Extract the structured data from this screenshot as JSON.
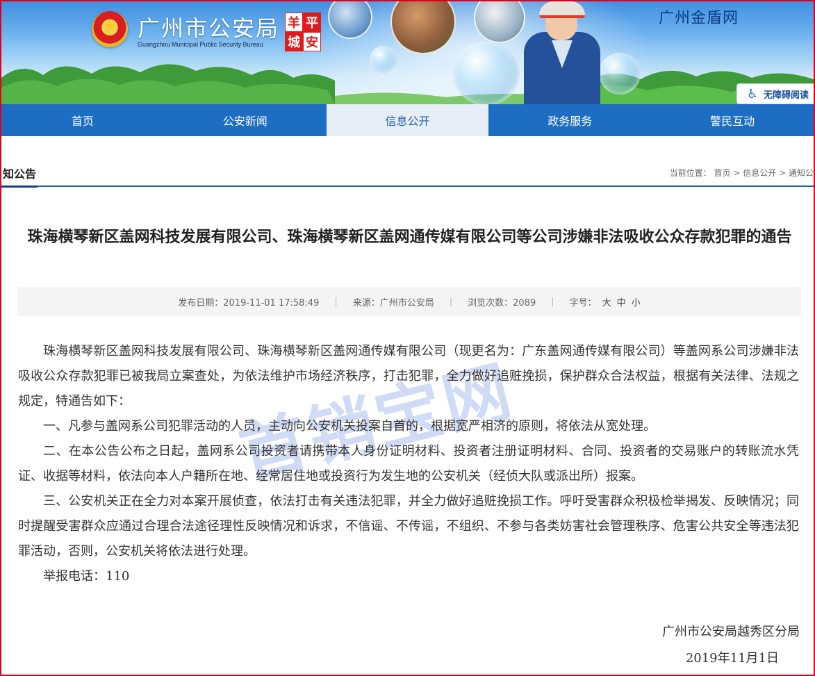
{
  "header": {
    "site_name": "广州市公安局",
    "site_name_en": "Guangzhou Municipal Public Security Bureau",
    "seal_chars": [
      "羊",
      "平",
      "城",
      "安"
    ],
    "right_title": "广州金盾网",
    "accessibility_label": "无障碍阅读"
  },
  "nav": {
    "items": [
      {
        "label": "首页"
      },
      {
        "label": "公安新闻"
      },
      {
        "label": "信息公开",
        "active": true
      },
      {
        "label": "政务服务"
      },
      {
        "label": "警民互动"
      }
    ]
  },
  "section": {
    "title": "知公告",
    "breadcrumb": {
      "prefix": "当前位置：",
      "items": [
        "首页",
        "信息公开",
        "通知公"
      ],
      "separator": ">"
    }
  },
  "article": {
    "title": "珠海横琴新区盖网科技发展有限公司、珠海横琴新区盖网通传媒有限公司等公司涉嫌非法吸收公众存款犯罪的通告",
    "meta": {
      "publish_date": "发布日期：2019-11-01 17:58:49",
      "source": "来源：广州市公安局",
      "views": "浏览次数：2089",
      "font_label": "字号：",
      "font_sizes": [
        "大",
        "中",
        "小"
      ]
    },
    "paragraphs": [
      "珠海横琴新区盖网科技发展有限公司、珠海横琴新区盖网通传媒有限公司（现更名为：广东盖网通传媒有限公司）等盖网系公司涉嫌非法吸收公众存款犯罪已被我局立案查处，为依法维护市场经济秩序，打击犯罪，全力做好追赃挽损，保护群众合法权益，根据有关法律、法规之规定，特通告如下：",
      "一、凡参与盖网系公司犯罪活动的人员，主动向公安机关投案自首的，根据宽严相济的原则，将依法从宽处理。",
      "二、在本公告公布之日起，盖网系公司投资者请携带本人身份证明材料、投资者注册证明材料、合同、投资者的交易账户的转账流水凭证、收据等材料，依法向本人户籍所在地、经常居住地或投资行为发生地的公安机关（经侦大队或派出所）报案。",
      "三、公安机关正在全力对本案开展侦查，依法打击有关违法犯罪，并全力做好追赃挽损工作。呼吁受害群众积极检举揭发、反映情况；同时提醒受害群众应通过合理合法途径理性反映情况和诉求，不信谣、不传谣，不组织、不参与各类妨害社会管理秩序、危害公共安全等违法犯罪活动，否则，公安机关将依法进行处理。",
      "举报电话：110"
    ],
    "signature": "广州市公安局越秀区分局",
    "date": "2019年11月1日"
  },
  "watermark": "首销宝网",
  "colors": {
    "frame": "#e0001b",
    "nav_bg": "#1d6ec3",
    "nav_active_bg": "#e8eef8",
    "accent": "#1d5fb0"
  }
}
